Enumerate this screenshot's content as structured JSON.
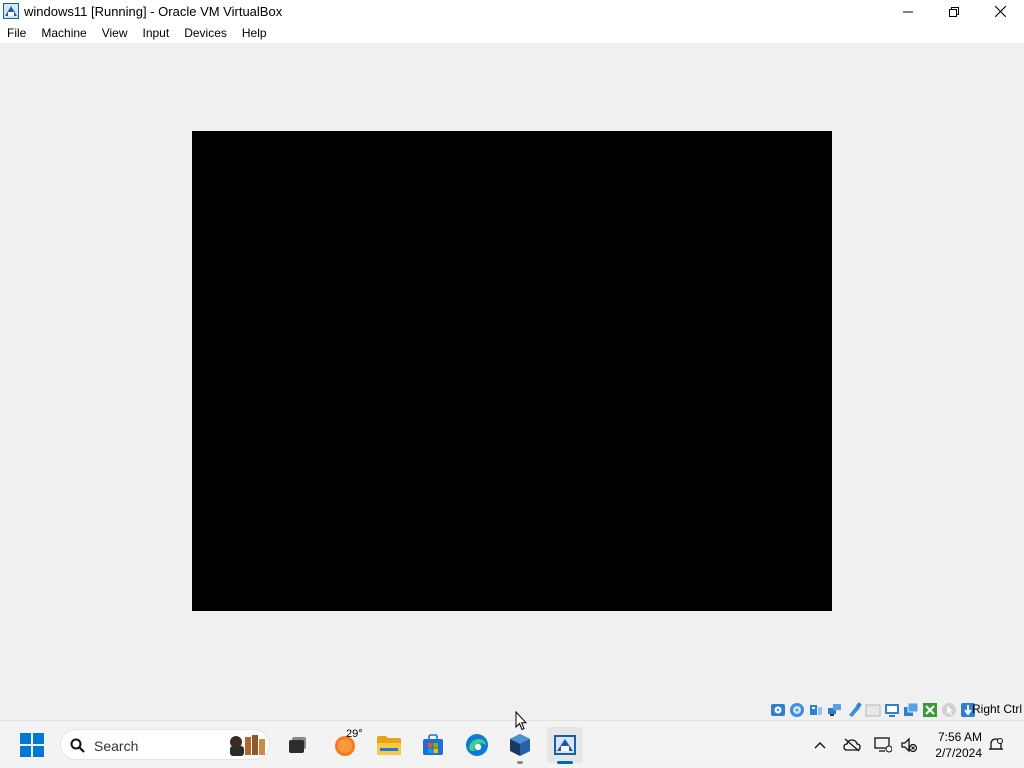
{
  "window": {
    "title": "windows11 [Running] - Oracle VM VirtualBox",
    "app_icon": "virtualbox-icon",
    "controls": [
      "minimize-icon",
      "restore-icon",
      "close-icon"
    ]
  },
  "menu": {
    "items": [
      {
        "label": "File"
      },
      {
        "label": "Machine"
      },
      {
        "label": "View"
      },
      {
        "label": "Input"
      },
      {
        "label": "Devices"
      },
      {
        "label": "Help"
      }
    ]
  },
  "vm_display": {
    "state": "black screen",
    "color": "#000000"
  },
  "statusbar": {
    "icons": [
      "hard-disk-icon",
      "optical-drive-icon",
      "audio-icon",
      "network-icon",
      "usb-icon",
      "shared-folders-icon",
      "display-icon",
      "recording-icon",
      "cpu-icon",
      "mouse-integration-icon",
      "keyboard-icon"
    ],
    "host_key": "Right Ctrl"
  },
  "taskbar": {
    "search_placeholder": "Search",
    "weather_temp": "29°",
    "apps": [
      {
        "name": "task-view",
        "icon": "task-view-icon"
      },
      {
        "name": "weather",
        "icon": "weather-icon"
      },
      {
        "name": "file-explorer",
        "icon": "folder-icon"
      },
      {
        "name": "microsoft-store",
        "icon": "store-icon"
      },
      {
        "name": "edge",
        "icon": "edge-icon"
      },
      {
        "name": "virtualbox",
        "icon": "virtualbox-icon",
        "open": true
      },
      {
        "name": "vm-window",
        "icon": "virtualbox-vm-icon",
        "active": true
      }
    ],
    "tray": {
      "icons": [
        "chevron-up-icon",
        "onedrive-icon",
        "network-icon",
        "volume-muted-icon",
        "notification-icon"
      ],
      "time": "7:56 AM",
      "date": "2/7/2024"
    }
  },
  "colors": {
    "accent": "#0067c0",
    "windows_blue": "#0078d4",
    "taskbar_bg": "#f3f3f3",
    "client_bg": "#f0f0f0"
  }
}
